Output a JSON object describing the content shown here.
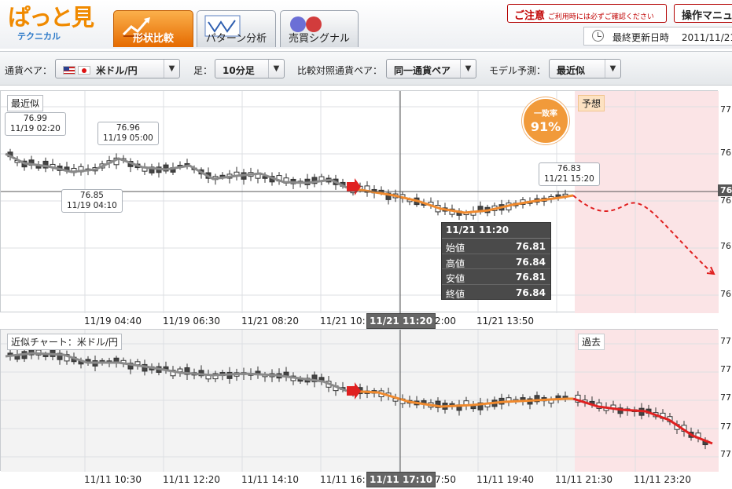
{
  "header": {
    "logo": {
      "main": "ぱっと見",
      "sub": "テクニカル"
    },
    "tabs": [
      {
        "label": "形状比較",
        "active": true,
        "icon": "chart-up-arrow-icon"
      },
      {
        "label": "パターン分析",
        "active": false,
        "icon": "pattern-wave-icon"
      },
      {
        "label": "売買シグナル",
        "active": false,
        "icon": "buy-sell-signal-icon"
      }
    ],
    "notice": {
      "title": "ご注意",
      "text": "ご利用時には必ずご確認ください"
    },
    "manual_label": "操作マニュ",
    "updated": {
      "label": "最終更新日時",
      "value": "2011/11/21"
    }
  },
  "toolbar": {
    "pair_label": "通貨ペア：",
    "pair_value": "米ドル/円",
    "period_label": "足：",
    "period_value": "10分足",
    "compare_label": "比較対照通貨ペア：",
    "compare_value": "同一通貨ペア",
    "model_label": "モデル予測：",
    "model_value": "最近似"
  },
  "top_chart": {
    "title": "最近似",
    "forecast_label": "予想",
    "match_badge": {
      "label": "一致率",
      "value": "91%"
    },
    "callouts": [
      {
        "price": "76.99",
        "time": "11/19 02:20"
      },
      {
        "price": "76.96",
        "time": "11/19 05:00"
      },
      {
        "price": "76.85",
        "time": "11/19 04:10"
      },
      {
        "price": "76.83",
        "time": "11/21 15:20"
      }
    ],
    "tooltip": {
      "time": "11/21 11:20",
      "rows": [
        {
          "key": "始値",
          "value": "76.81"
        },
        {
          "key": "高値",
          "value": "76.84"
        },
        {
          "key": "安値",
          "value": "76.81"
        },
        {
          "key": "終値",
          "value": "76.84"
        }
      ]
    },
    "y_ticks": [
      "77",
      "76",
      "76",
      "76",
      "76"
    ],
    "y_current": "76",
    "x_ticks": [
      "11/19 04:40",
      "11/19 06:30",
      "11/21 08:20",
      "11/21 10:",
      "2:00",
      "11/21 13:50"
    ],
    "x_selected": "11/21 11:20"
  },
  "bottom_chart": {
    "title": "近似チャート：米ドル/円",
    "past_label": "過去",
    "y_ticks": [
      "77",
      "77",
      "77",
      "77",
      "77"
    ],
    "x_ticks": [
      "11/11 10:30",
      "11/11 12:20",
      "11/11 14:10",
      "11/11 16:",
      "7:50",
      "11/11 19:40",
      "11/11 21:30",
      "11/11 23:20"
    ],
    "x_selected": "11/11 17:10"
  },
  "colors": {
    "accent": "#f08a00",
    "forecast_shade": "#fbe4e6",
    "fit_line": "#f08a2e",
    "forecast_line": "#e02020",
    "candle": "#333333"
  }
}
